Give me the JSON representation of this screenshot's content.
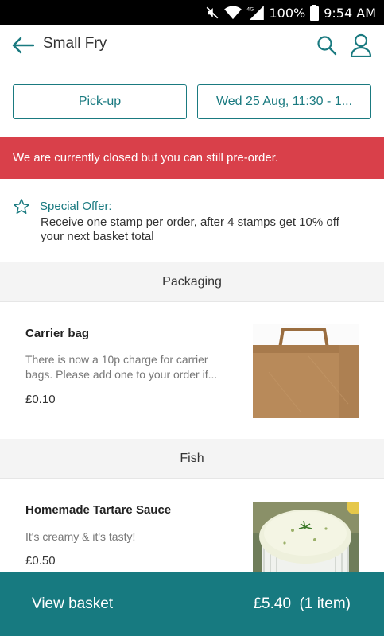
{
  "status_bar": {
    "battery": "100%",
    "time": "9:54 AM",
    "network": "4G"
  },
  "app_bar": {
    "title": "Small Fry"
  },
  "order_options": {
    "mode_label": "Pick-up",
    "time_label": "Wed 25 Aug, 11:30 - 1..."
  },
  "banner": {
    "text": "We are currently closed but you can still pre-order."
  },
  "offer": {
    "title": "Special Offer:",
    "description": "Receive one stamp per order, after 4 stamps get 10% off your next basket total"
  },
  "sections": [
    {
      "title": "Packaging",
      "items": [
        {
          "name": "Carrier bag",
          "description": "There is now a 10p charge for carrier bags. Please add one to your order if...",
          "price": "£0.10",
          "image": "paper-carrier-bag"
        }
      ]
    },
    {
      "title": "Fish",
      "items": [
        {
          "name": "Homemade Tartare Sauce",
          "description": "It's creamy & it's tasty!",
          "price": "£0.50",
          "image": "tartare-sauce-bowl"
        }
      ]
    }
  ],
  "basket": {
    "label": "View basket",
    "total": "£5.40",
    "count": "(1 item)"
  },
  "colors": {
    "accent": "#1a7a80",
    "banner": "#d9404a",
    "basket_bar": "#177a80"
  }
}
